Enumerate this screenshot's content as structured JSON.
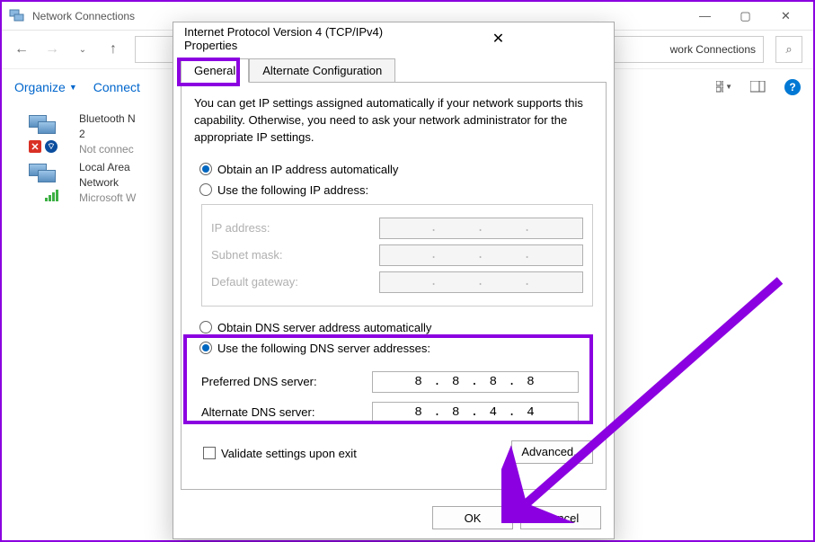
{
  "window": {
    "title": "Network Connections",
    "addressTail": "work Connections"
  },
  "toolbar": {
    "organize": "Organize",
    "connect": "Connect"
  },
  "connections": [
    {
      "name": "Bluetooth N",
      "line2": "2",
      "status": "Not connec",
      "badges": {
        "x": true,
        "bt": true,
        "signal": false
      }
    },
    {
      "name": "Local Area",
      "line2": "Network",
      "status": "Microsoft W",
      "badges": {
        "x": false,
        "bt": false,
        "signal": true
      }
    }
  ],
  "dialog": {
    "title": "Internet Protocol Version 4 (TCP/IPv4) Properties",
    "tabs": {
      "general": "General",
      "alternate": "Alternate Configuration"
    },
    "hint": "You can get IP settings assigned automatically if your network supports this capability. Otherwise, you need to ask your network administrator for the appropriate IP settings.",
    "radio_ip_auto": "Obtain an IP address automatically",
    "radio_ip_manual": "Use the following IP address:",
    "field_ip": "IP address:",
    "field_subnet": "Subnet mask:",
    "field_gateway": "Default gateway:",
    "radio_dns_auto": "Obtain DNS server address automatically",
    "radio_dns_manual": "Use the following DNS server addresses:",
    "field_dns_pref": "Preferred DNS server:",
    "field_dns_alt": "Alternate DNS server:",
    "dns_pref_value": "8 . 8 . 8 . 8",
    "dns_alt_value": "8 . 8 . 4 . 4",
    "checkbox_validate": "Validate settings upon exit",
    "btn_advanced": "Advanced...",
    "btn_ok": "OK",
    "btn_cancel": "Cancel"
  }
}
